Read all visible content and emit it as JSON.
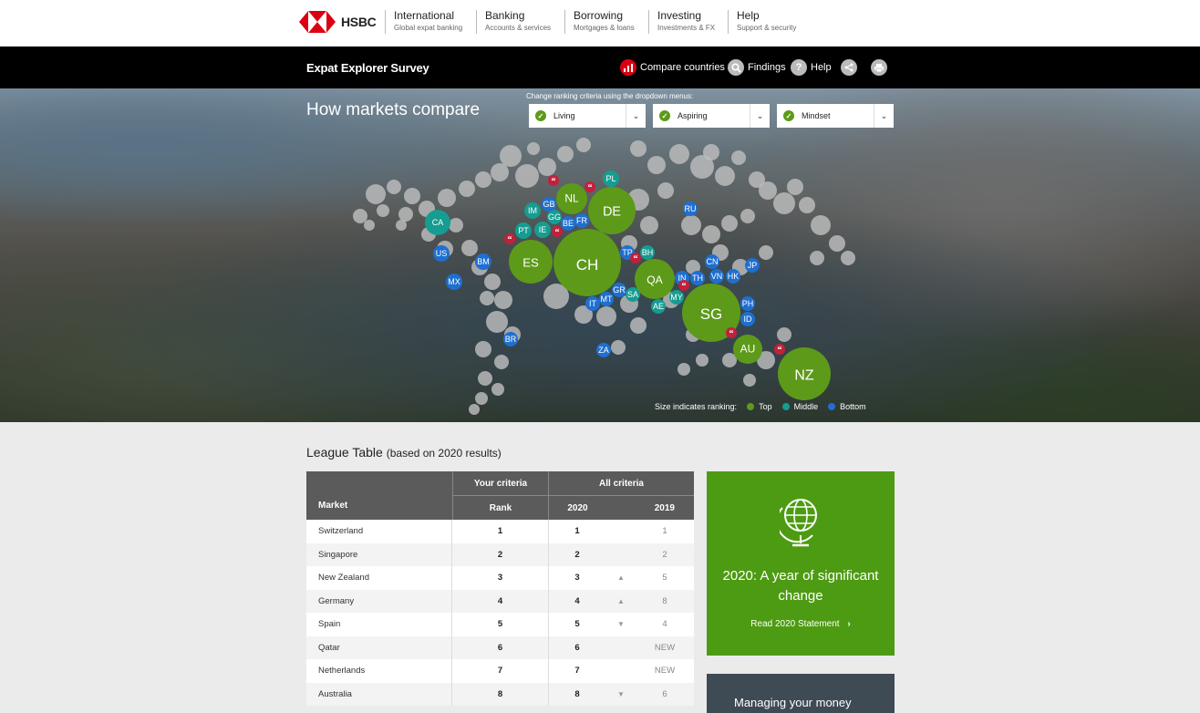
{
  "nav": {
    "brand": "HSBC",
    "items": [
      {
        "title": "International",
        "sub": "Global expat banking"
      },
      {
        "title": "Banking",
        "sub": "Accounts & services"
      },
      {
        "title": "Borrowing",
        "sub": "Mortgages & loans"
      },
      {
        "title": "Investing",
        "sub": "Investments & FX"
      },
      {
        "title": "Help",
        "sub": "Support & security"
      }
    ]
  },
  "survey": {
    "title": "Expat Explorer Survey",
    "compare": "Compare countries",
    "findings": "Findings",
    "help": "Help"
  },
  "hero": {
    "heading": "How markets compare",
    "dropdown_hint": "Change ranking criteria using the dropdown menus:",
    "dropdowns": [
      "Living",
      "Aspiring",
      "Mindset"
    ],
    "legend": {
      "label": "Size indicates ranking:",
      "top": "Top",
      "middle": "Middle",
      "bottom": "Bottom"
    },
    "colors": {
      "top": "#5d9a1a",
      "middle": "#169c91",
      "bottom": "#1f6fd0",
      "quote": "#c2203b",
      "grey": "#bdbdbd"
    }
  },
  "bubbles": [
    {
      "label": "NL",
      "tier": "top"
    },
    {
      "label": "DE",
      "tier": "top"
    },
    {
      "label": "ES",
      "tier": "top"
    },
    {
      "label": "CH",
      "tier": "top"
    },
    {
      "label": "QA",
      "tier": "top"
    },
    {
      "label": "SG",
      "tier": "top"
    },
    {
      "label": "AU",
      "tier": "top"
    },
    {
      "label": "NZ",
      "tier": "top"
    },
    {
      "label": "CA",
      "tier": "middle"
    },
    {
      "label": "IM",
      "tier": "middle"
    },
    {
      "label": "GG",
      "tier": "middle"
    },
    {
      "label": "PT",
      "tier": "middle"
    },
    {
      "label": "IE",
      "tier": "middle"
    },
    {
      "label": "PL",
      "tier": "middle"
    },
    {
      "label": "BH",
      "tier": "middle"
    },
    {
      "label": "SA",
      "tier": "middle"
    },
    {
      "label": "AE",
      "tier": "middle"
    },
    {
      "label": "MY",
      "tier": "middle"
    },
    {
      "label": "US",
      "tier": "bottom"
    },
    {
      "label": "BM",
      "tier": "bottom"
    },
    {
      "label": "MX",
      "tier": "bottom"
    },
    {
      "label": "BR",
      "tier": "bottom"
    },
    {
      "label": "GB",
      "tier": "bottom"
    },
    {
      "label": "BE",
      "tier": "bottom"
    },
    {
      "label": "FR",
      "tier": "bottom"
    },
    {
      "label": "RU",
      "tier": "bottom"
    },
    {
      "label": "TP",
      "tier": "bottom"
    },
    {
      "label": "CN",
      "tier": "bottom"
    },
    {
      "label": "JP",
      "tier": "bottom"
    },
    {
      "label": "IN",
      "tier": "bottom"
    },
    {
      "label": "TH",
      "tier": "bottom"
    },
    {
      "label": "VN",
      "tier": "bottom"
    },
    {
      "label": "HK",
      "tier": "bottom"
    },
    {
      "label": "GR",
      "tier": "bottom"
    },
    {
      "label": "MT",
      "tier": "bottom"
    },
    {
      "label": "IT",
      "tier": "bottom"
    },
    {
      "label": "PH",
      "tier": "bottom"
    },
    {
      "label": "ID",
      "tier": "bottom"
    },
    {
      "label": "ZA",
      "tier": "bottom"
    }
  ],
  "league": {
    "title": "League Table",
    "subtitle": "(based on 2020 results)",
    "headers": {
      "market": "Market",
      "your_criteria": "Your criteria",
      "all_criteria": "All criteria",
      "rank": "Rank",
      "y2020": "2020",
      "y2019": "2019"
    },
    "rows": [
      {
        "market": "Switzerland",
        "rank": "1",
        "y2020": "1",
        "trend": "",
        "y2019": "1"
      },
      {
        "market": "Singapore",
        "rank": "2",
        "y2020": "2",
        "trend": "",
        "y2019": "2"
      },
      {
        "market": "New Zealand",
        "rank": "3",
        "y2020": "3",
        "trend": "up",
        "y2019": "5"
      },
      {
        "market": "Germany",
        "rank": "4",
        "y2020": "4",
        "trend": "up",
        "y2019": "8"
      },
      {
        "market": "Spain",
        "rank": "5",
        "y2020": "5",
        "trend": "down",
        "y2019": "4"
      },
      {
        "market": "Qatar",
        "rank": "6",
        "y2020": "6",
        "trend": "",
        "y2019": "NEW"
      },
      {
        "market": "Netherlands",
        "rank": "7",
        "y2020": "7",
        "trend": "",
        "y2019": "NEW"
      },
      {
        "market": "Australia",
        "rank": "8",
        "y2020": "8",
        "trend": "down",
        "y2019": "6"
      }
    ]
  },
  "cards": {
    "statement_title": "2020: A year of significant change",
    "statement_link": "Read 2020 Statement",
    "money_title": "Managing your money"
  }
}
